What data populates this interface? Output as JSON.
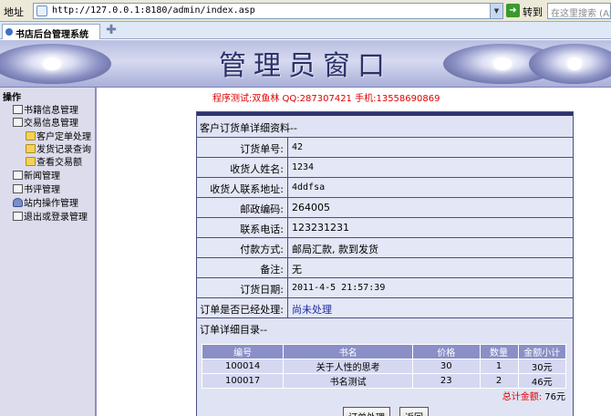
{
  "browser": {
    "address_label": "地址",
    "url": "http://127.0.0.1:8180/admin/index.asp",
    "go_label": "转到",
    "search_placeholder": "在这里搜索 (Alt+C)",
    "tab_title": "书店后台管理系统"
  },
  "banner": {
    "title": "管理员窗口"
  },
  "sidebar": {
    "heading": "操作",
    "items": [
      {
        "label": "书籍信息管理",
        "icon": "doc-icon"
      },
      {
        "label": "交易信息管理",
        "icon": "doc-icon"
      },
      {
        "label": "客户定单处理",
        "icon": "folder-icon"
      },
      {
        "label": "发货记录查询",
        "icon": "folder-icon"
      },
      {
        "label": "查看交易额",
        "icon": "folder-icon"
      },
      {
        "label": "新闻管理",
        "icon": "doc-icon"
      },
      {
        "label": "书评管理",
        "icon": "doc-icon"
      },
      {
        "label": "站内操作管理",
        "icon": "user-icon"
      },
      {
        "label": "退出或登录管理",
        "icon": "doc-icon"
      }
    ]
  },
  "main": {
    "notice": "程序测试:双鱼林 QQ:287307421 手机:13558690869",
    "panel_title": "客户订货单详细资料--",
    "fields": [
      {
        "label": "订货单号:",
        "value": "42"
      },
      {
        "label": "收货人姓名:",
        "value": "1234"
      },
      {
        "label": "收货人联系地址:",
        "value": "4ddfsa"
      },
      {
        "label": "邮政编码:",
        "value": "264005"
      },
      {
        "label": "联系电话:",
        "value": "123231231"
      },
      {
        "label": "付款方式:",
        "value": "邮局汇款, 款到发货"
      },
      {
        "label": "备注:",
        "value": "无"
      },
      {
        "label": "订货日期:",
        "value": "2011-4-5 21:57:39"
      },
      {
        "label": "订单是否已经处理:",
        "value": "尚未处理"
      }
    ],
    "detail_title": "订单详细目录--",
    "table": {
      "headers": [
        "编号",
        "书名",
        "价格",
        "数量",
        "金额小计"
      ],
      "rows": [
        [
          "100014",
          "关于人性的思考",
          "30",
          "1",
          "30元"
        ],
        [
          "100017",
          "书名测试",
          "23",
          "2",
          "46元"
        ]
      ]
    },
    "total_label": "总计金额:",
    "total_value": "76元",
    "buttons": {
      "process": "订单处理",
      "back": "返回"
    }
  }
}
